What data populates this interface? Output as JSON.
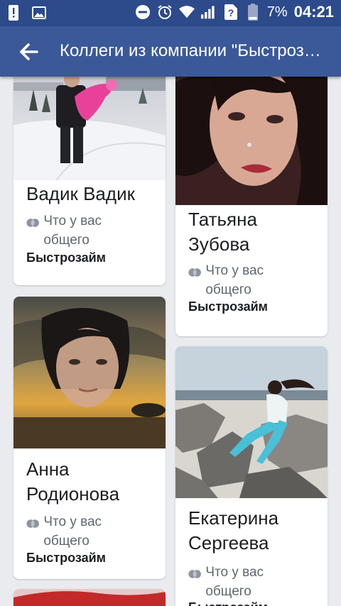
{
  "status_bar": {
    "battery_percent": "7%",
    "time": "04:21"
  },
  "appbar": {
    "title": "Коллеги из компании \"Быстрозайм\""
  },
  "cards": [
    {
      "name": "Вадик Вадик",
      "mutual": "Что у вас общего",
      "company": "Быстрозайм"
    },
    {
      "name": "Татьяна Зубова",
      "mutual": "Что у вас общего",
      "company": "Быстрозайм"
    },
    {
      "name": "Анна Родионова",
      "mutual": "Что у вас общего",
      "company": "Быстрозайм"
    },
    {
      "name": "Екатерина Сергеева",
      "mutual": "Что у вас общего",
      "company": "Быстрозайм"
    }
  ],
  "colors": {
    "status_bar": "#2d4a8a",
    "app_bar": "#3b5998",
    "background": "#e9ebee"
  }
}
